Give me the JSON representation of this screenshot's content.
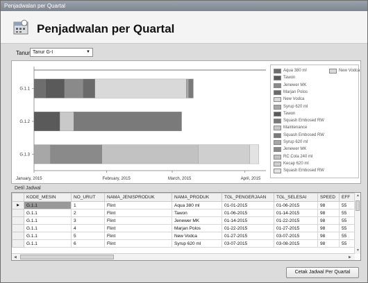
{
  "window": {
    "title": "Penjadwalan per Quartal"
  },
  "header": {
    "title": "Penjadwalan per Quartal"
  },
  "filter": {
    "label": "Tanur",
    "value": "Tanur G-I"
  },
  "colors": {
    "Aqua 380 ml": "#6e6e6e",
    "New Vodca": "#d9d9d9",
    "Tawon": "#5a5a5a",
    "Jenewer MK": "#8a8a8a",
    "Marjan Polos": "#6a6a6a",
    "Syrup 620 ml": "#a7a7a7",
    "Squash Embosed RW": "#7a7a7a",
    "Maintenance": "#c9c9c9",
    "RC Cola 240 ml": "#c2c2c2",
    "Kecap 620 ml": "#cfcfcf",
    "Squash Embosed RW 2": "#e3e3e3"
  },
  "chart_data": {
    "type": "gantt",
    "categories": [
      "G.1.1",
      "G.1.2",
      "G.1.3"
    ],
    "x_ticks": [
      "January, 2015",
      "February, 2015",
      "March, 2015",
      "April, 2015"
    ],
    "x_range": [
      "2015-01-01",
      "2015-04-10"
    ],
    "legend": [
      "Aqua 380 ml",
      "New Vodca",
      "Tawon",
      "Jenewer MK",
      "Marjan Polos",
      "New Vodca",
      "Syrup 620 ml",
      "Tawon",
      "Squash Embosed RW",
      "Maintenance",
      "Squash Embosed RW",
      "Syrup 620 ml",
      "Jenewer MK",
      "RC Cola 240 ml",
      "Kecap 620 ml",
      "Squash Embosed RW"
    ],
    "tasks": [
      {
        "machine": "G.1.1",
        "product": "Aqua 380 ml",
        "start": "2015-01-01",
        "end": "2015-01-06"
      },
      {
        "machine": "G.1.1",
        "product": "Tawon",
        "start": "2015-01-06",
        "end": "2015-01-14"
      },
      {
        "machine": "G.1.1",
        "product": "Jenewer MK",
        "start": "2015-01-14",
        "end": "2015-01-22"
      },
      {
        "machine": "G.1.1",
        "product": "Marjan Polos",
        "start": "2015-01-22",
        "end": "2015-01-27"
      },
      {
        "machine": "G.1.1",
        "product": "New Vodca",
        "start": "2015-01-27",
        "end": "2015-03-07"
      },
      {
        "machine": "G.1.1",
        "product": "Syrup 620 ml",
        "start": "2015-03-07",
        "end": "2015-03-08"
      },
      {
        "machine": "G.1.1",
        "product": "Squash Embosed RW",
        "start": "2015-03-08",
        "end": "2015-03-10"
      },
      {
        "machine": "G.1.2",
        "product": "Tawon",
        "start": "2015-01-01",
        "end": "2015-01-12"
      },
      {
        "machine": "G.1.2",
        "product": "Maintenance",
        "start": "2015-01-12",
        "end": "2015-01-18"
      },
      {
        "machine": "G.1.2",
        "product": "Squash Embosed RW",
        "start": "2015-01-18",
        "end": "2015-03-05"
      },
      {
        "machine": "G.1.3",
        "product": "Syrup 620 ml",
        "start": "2015-01-01",
        "end": "2015-01-08"
      },
      {
        "machine": "G.1.3",
        "product": "Jenewer MK",
        "start": "2015-01-08",
        "end": "2015-01-30"
      },
      {
        "machine": "G.1.3",
        "product": "RC Cola 240 ml",
        "start": "2015-01-30",
        "end": "2015-03-12"
      },
      {
        "machine": "G.1.3",
        "product": "Kecap 620 ml",
        "start": "2015-03-12",
        "end": "2015-04-03"
      },
      {
        "machine": "G.1.3",
        "product": "Squash Embosed RW 2",
        "start": "2015-04-03",
        "end": "2015-04-07"
      }
    ]
  },
  "detail": {
    "label": "Detil Jadwal",
    "columns": [
      "KODE_MESIN",
      "NO_URUT",
      "NAMA_JENISPRODUK",
      "NAMA_PRODUK",
      "TGL_PENGERJAAN",
      "TGL_SELESAI",
      "SPEED",
      "EFF"
    ],
    "rows": [
      [
        "G.1.1",
        "1",
        "Flint",
        "Aqua 380 ml",
        "01-01-2015",
        "01-06-2015",
        "98",
        "55"
      ],
      [
        "G.1.1",
        "2",
        "Flint",
        "Tawon",
        "01-06-2015",
        "01-14-2015",
        "98",
        "55"
      ],
      [
        "G.1.1",
        "3",
        "Flint",
        "Jenewer MK",
        "01-14-2015",
        "01-22-2015",
        "98",
        "55"
      ],
      [
        "G.1.1",
        "4",
        "Flint",
        "Marjan Polos",
        "01-22-2015",
        "01-27-2015",
        "98",
        "55"
      ],
      [
        "G.1.1",
        "5",
        "Flint",
        "New Vodca",
        "01-27-2015",
        "03-07-2015",
        "98",
        "55"
      ],
      [
        "G.1.1",
        "6",
        "Flint",
        "Syrup 620 ml",
        "03-07-2015",
        "03-08-2015",
        "98",
        "55"
      ]
    ]
  },
  "actions": {
    "print": "Cetak Jadwal Per Quartal"
  }
}
